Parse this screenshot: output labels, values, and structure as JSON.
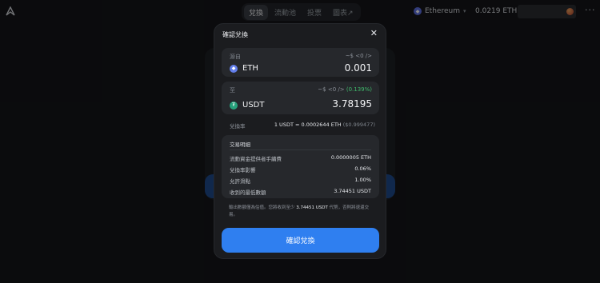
{
  "nav": {
    "items": [
      "兌換",
      "流動池",
      "投票",
      "圖表↗"
    ],
    "active_index": 0
  },
  "header": {
    "network": "Ethereum",
    "network_icon": "ethereum-icon",
    "balance": "0.0219 ETH",
    "more": "···"
  },
  "modal": {
    "title": "確認兌換",
    "close_icon": "✕",
    "from": {
      "label": "源自",
      "usd": "~$ <0 />",
      "token": "ETH",
      "amount": "0.001",
      "icon_color": "#627eea"
    },
    "to": {
      "label": "至",
      "usd": "~$ <0 />",
      "pct": "(0.139%)",
      "token": "USDT",
      "amount": "3.78195",
      "icon_color": "#26a17b"
    },
    "rate": {
      "label": "兌換率",
      "value": "1 USDT = 0.0002644 ETH",
      "sub": "($0.999477)"
    },
    "details": {
      "title": "交易明細",
      "rows": [
        {
          "k": "流動資金提供者手續費",
          "v": "0.0000005 ETH"
        },
        {
          "k": "兌換率影響",
          "v": "0.06%"
        },
        {
          "k": "允許滑點",
          "v": "1.00%"
        },
        {
          "k": "收到的最低數額",
          "v": "3.74451 USDT"
        }
      ]
    },
    "note": {
      "pre": "輸出數額僅為估值。您將收到至少",
      "amount": "3.74451 USDT",
      "post": "代幣，否則將退還交易。"
    },
    "confirm_label": "確認兌換"
  },
  "colors": {
    "accent": "#2f7ff0",
    "positive": "#3fb96b",
    "background": "#141518"
  }
}
